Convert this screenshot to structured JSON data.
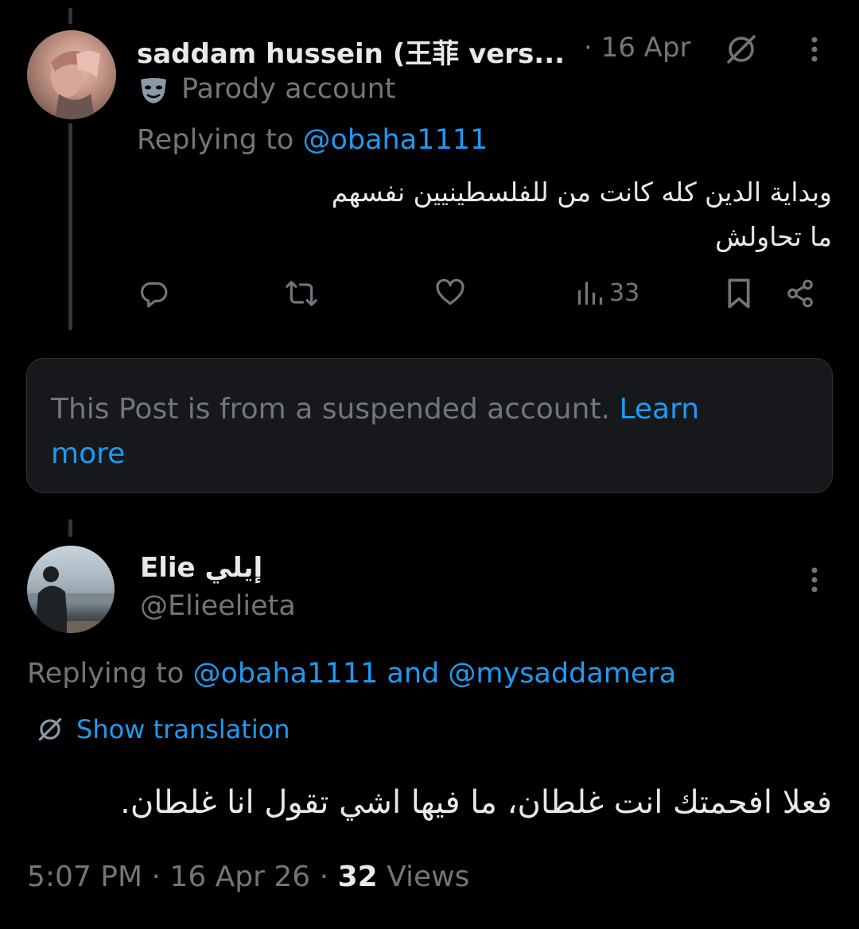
{
  "tweet1": {
    "display_name": "saddam hussein (王菲 vers...",
    "date": "· 16 Apr",
    "badge_label": "Parody account",
    "replying_prefix": "Replying to",
    "replying_handle": "@obaha1111",
    "text_line1": "وبداية الدين كله كانت من للفلسطينيين نفسهم",
    "text_line2": "ما تحاولش",
    "views": "33"
  },
  "suspended": {
    "text": "This Post is from a suspended account.",
    "link": "Learn",
    "link2": "more"
  },
  "tweet2": {
    "display_name": "Elie",
    "display_name_ar": "إيلي",
    "handle": "@Elieelieta",
    "replying_prefix": "Replying to",
    "replying_handle1": "@obaha1111",
    "replying_and": "and",
    "replying_handle2": "@mysaddamera",
    "show_translation": "Show translation",
    "text": "فعلا افحمتك انت غلطان، ما فيها اشي تقول انا غلطان.",
    "time": "5:07 PM",
    "date": "16 Apr 26",
    "views_count": "32",
    "views_label": "Views",
    "sep": "·"
  },
  "icons": {
    "grok": "grok-icon",
    "more": "more-dots-icon",
    "mask": "parody-mask-icon",
    "reply": "reply-icon",
    "retweet": "retweet-icon",
    "like": "like-icon",
    "views": "views-icon",
    "bookmark": "bookmark-icon",
    "share": "share-icon",
    "translate": "translate-icon"
  },
  "colors": {
    "background": "#000000",
    "text": "#e7e9ea",
    "muted": "#71767b",
    "link": "#1d9bf0",
    "card": "#16181c"
  }
}
